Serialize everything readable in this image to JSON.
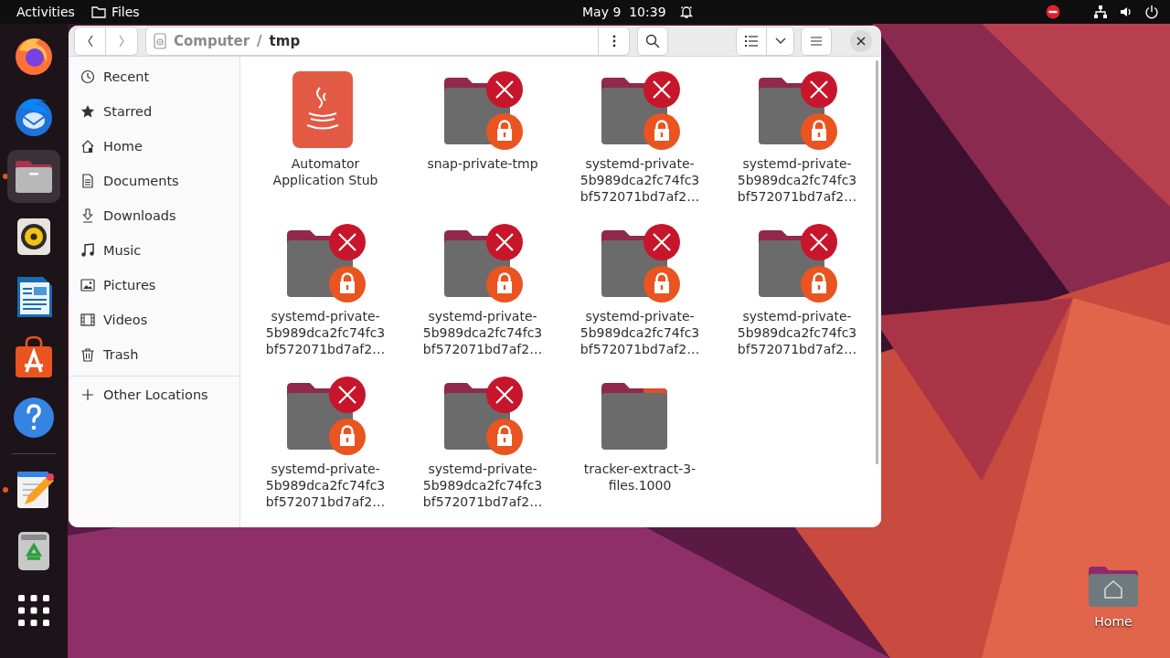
{
  "top_bar": {
    "activities": "Activities",
    "app_name": "Files",
    "clock": "May 9  10:39"
  },
  "dock": [
    {
      "kind": "firefox",
      "running": false,
      "active": false
    },
    {
      "kind": "thunderbird",
      "running": false,
      "active": false
    },
    {
      "kind": "files",
      "running": true,
      "active": true
    },
    {
      "kind": "rhythmbox",
      "running": false,
      "active": false
    },
    {
      "kind": "writer",
      "running": false,
      "active": false
    },
    {
      "kind": "app-center",
      "running": false,
      "active": false
    },
    {
      "kind": "help",
      "running": false,
      "active": false
    },
    {
      "kind": "separator"
    },
    {
      "kind": "text-editor",
      "running": true,
      "active": false
    },
    {
      "kind": "trash",
      "running": false,
      "active": false
    },
    {
      "kind": "app-grid",
      "running": false,
      "active": false
    }
  ],
  "window": {
    "path": {
      "segments": [
        {
          "label": "Computer",
          "current": false
        },
        {
          "label": "tmp",
          "current": true
        }
      ],
      "separator": "/"
    },
    "sidebar": {
      "places": [
        {
          "kind": "recent",
          "label": "Recent",
          "selected": false
        },
        {
          "kind": "starred",
          "label": "Starred",
          "selected": false
        },
        {
          "kind": "home",
          "label": "Home",
          "selected": false
        },
        {
          "kind": "documents",
          "label": "Documents",
          "selected": false
        },
        {
          "kind": "downloads",
          "label": "Downloads",
          "selected": false
        },
        {
          "kind": "music",
          "label": "Music",
          "selected": false
        },
        {
          "kind": "pictures",
          "label": "Pictures",
          "selected": false
        },
        {
          "kind": "videos",
          "label": "Videos",
          "selected": false
        },
        {
          "kind": "trash",
          "label": "Trash",
          "selected": false
        }
      ],
      "other": [
        {
          "kind": "plus",
          "label": "Other Locations",
          "selected": false
        }
      ]
    },
    "files": [
      {
        "kind": "java",
        "label": [
          "Automator",
          "Application Stub"
        ]
      },
      {
        "kind": "locked-folder",
        "label": [
          "snap-private-tmp"
        ]
      },
      {
        "kind": "locked-folder",
        "label": [
          "systemd-private-",
          "5b989dca2fc74fc3",
          "bf572071bd7af2…"
        ]
      },
      {
        "kind": "locked-folder",
        "label": [
          "systemd-private-",
          "5b989dca2fc74fc3",
          "bf572071bd7af2…"
        ]
      },
      {
        "kind": "locked-folder",
        "label": [
          "systemd-private-",
          "5b989dca2fc74fc3",
          "bf572071bd7af2…"
        ]
      },
      {
        "kind": "locked-folder",
        "label": [
          "systemd-private-",
          "5b989dca2fc74fc3",
          "bf572071bd7af2…"
        ]
      },
      {
        "kind": "locked-folder",
        "label": [
          "systemd-private-",
          "5b989dca2fc74fc3",
          "bf572071bd7af2…"
        ]
      },
      {
        "kind": "locked-folder",
        "label": [
          "systemd-private-",
          "5b989dca2fc74fc3",
          "bf572071bd7af2…"
        ]
      },
      {
        "kind": "locked-folder",
        "label": [
          "systemd-private-",
          "5b989dca2fc74fc3",
          "bf572071bd7af2…"
        ]
      },
      {
        "kind": "locked-folder",
        "label": [
          "systemd-private-",
          "5b989dca2fc74fc3",
          "bf572071bd7af2…"
        ]
      },
      {
        "kind": "folder",
        "label": [
          "tracker-extract-3-",
          "files.1000"
        ]
      }
    ]
  },
  "desktop": [
    {
      "kind": "home-folder",
      "label": "Home"
    }
  ]
}
